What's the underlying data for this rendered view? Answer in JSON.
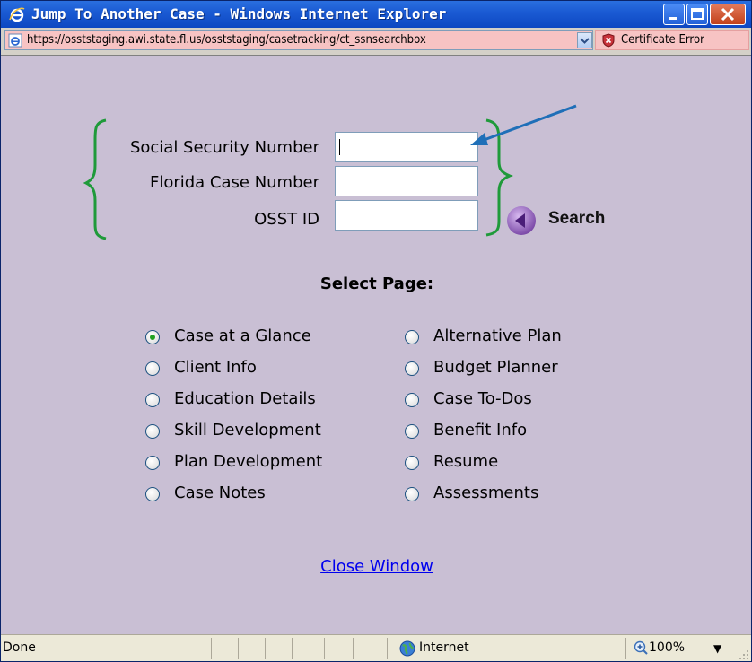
{
  "window": {
    "title": "Jump To Another Case - Windows Internet Explorer"
  },
  "address_bar": {
    "url": "https://osststaging.awi.state.fl.us/osststaging/casetracking/ct_ssnsearchbox",
    "certificate_label": "Certificate Error"
  },
  "form": {
    "ssn_label": "Social Security Number",
    "ssn_value": "",
    "case_number_label": "Florida Case Number",
    "case_number_value": "",
    "osst_id_label": "OSST ID",
    "osst_id_value": "",
    "search_label": "Search"
  },
  "select_page": {
    "heading": "Select Page:",
    "left_options": [
      {
        "label": "Case at a Glance",
        "checked": true
      },
      {
        "label": "Client Info",
        "checked": false
      },
      {
        "label": "Education Details",
        "checked": false
      },
      {
        "label": "Skill Development",
        "checked": false
      },
      {
        "label": "Plan Development",
        "checked": false
      },
      {
        "label": "Case Notes",
        "checked": false
      }
    ],
    "right_options": [
      {
        "label": "Alternative Plan",
        "checked": false
      },
      {
        "label": "Budget Planner",
        "checked": false
      },
      {
        "label": "Case To-Dos",
        "checked": false
      },
      {
        "label": "Benefit Info",
        "checked": false
      },
      {
        "label": "Resume",
        "checked": false
      },
      {
        "label": "Assessments",
        "checked": false
      }
    ]
  },
  "close_link": "Close Window",
  "status_bar": {
    "status": "Done",
    "zone": "Internet",
    "zoom": "100%"
  },
  "colors": {
    "content_bg": "#c9bfd4",
    "brace_green": "#1f9a3a",
    "arrow_blue": "#1f6fb8",
    "link_blue": "#0000ee",
    "search_icon_purple": "#8e5fb8"
  },
  "icons": {
    "title": "ie-logo-icon",
    "page": "ie-page-icon",
    "certificate": "certificate-error-icon",
    "search": "left-arrow-circle-icon",
    "zone": "globe-icon",
    "zoom": "zoom-icon"
  }
}
